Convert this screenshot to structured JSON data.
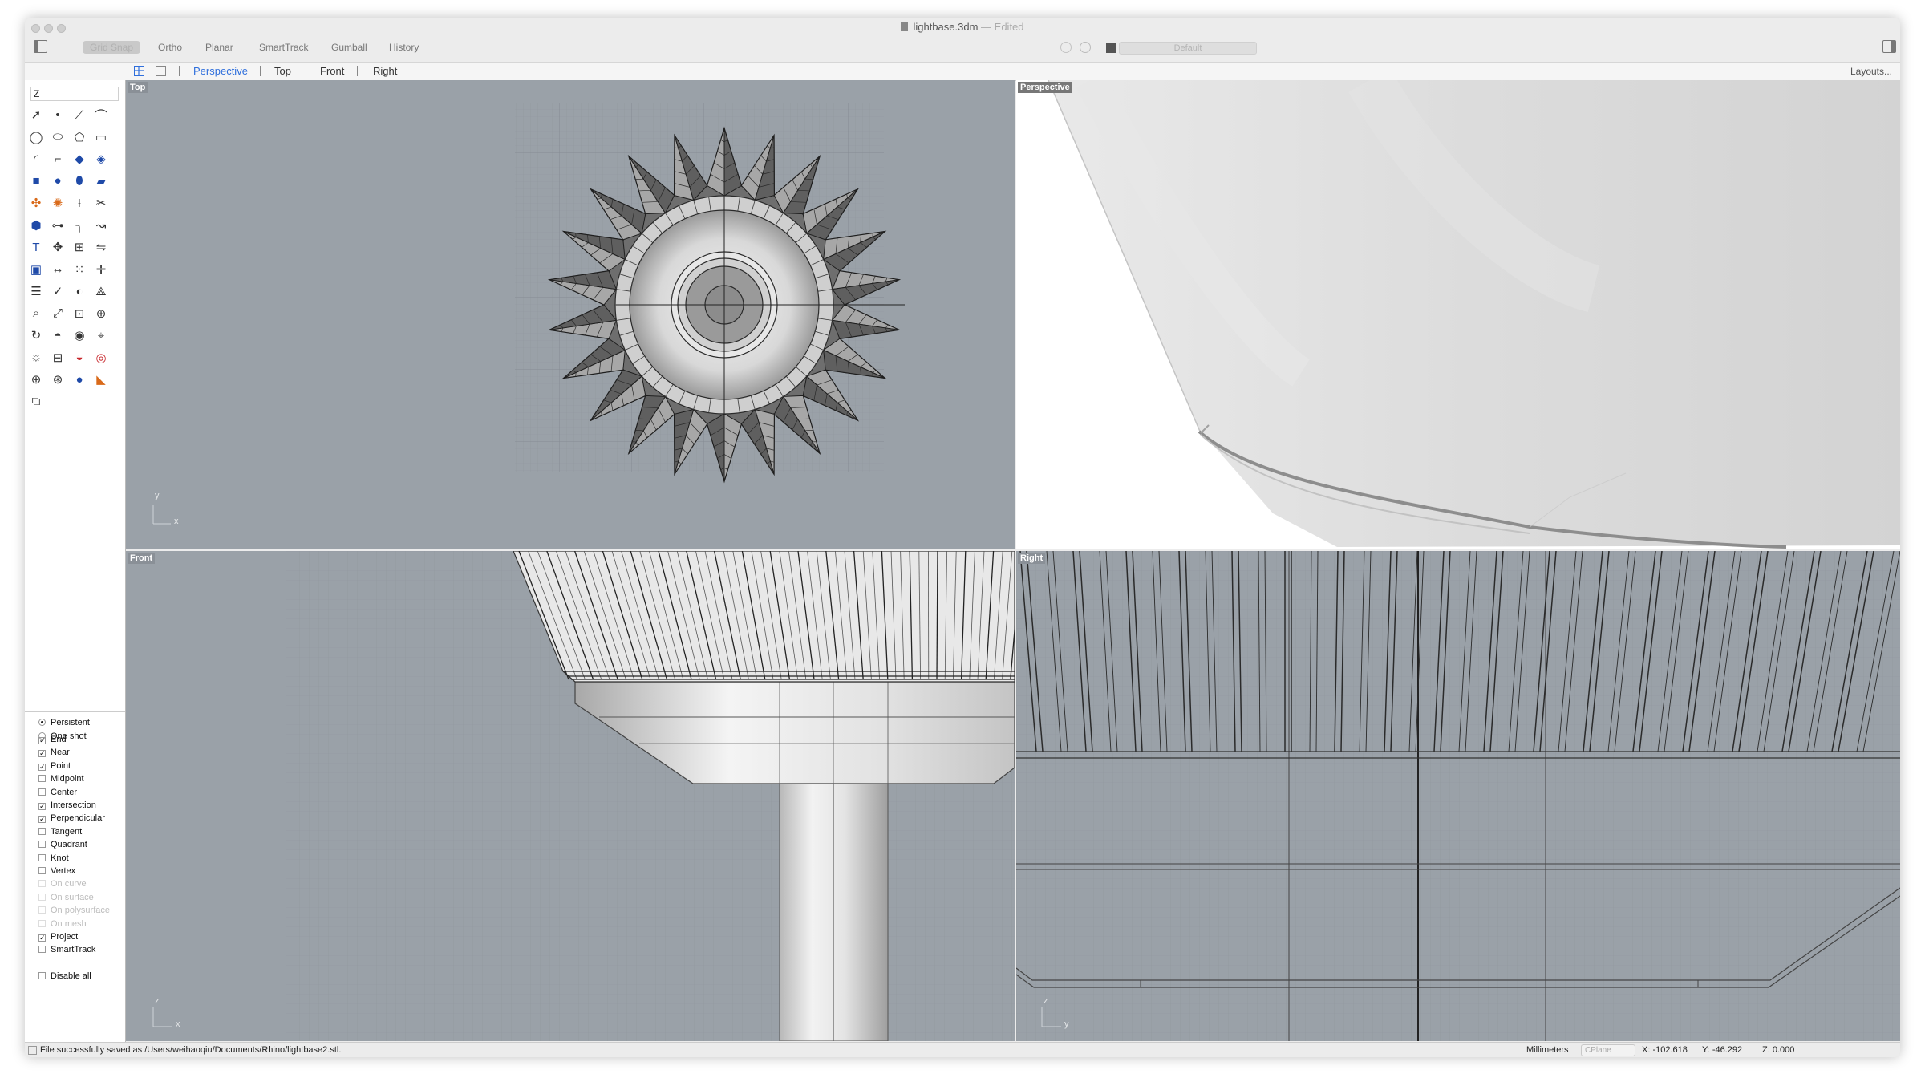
{
  "window": {
    "title": "lightbase.3dm",
    "title_separator": "—",
    "edited_label": "Edited"
  },
  "toolbar": {
    "toggles": [
      "Grid Snap",
      "Ortho",
      "Planar",
      "SmartTrack",
      "Gumball",
      "History"
    ],
    "active_toggle": "Grid Snap",
    "layer": "Default"
  },
  "viewport_tabs": {
    "items": [
      "Perspective",
      "Top",
      "Front",
      "Right"
    ],
    "active": "Perspective",
    "layouts_label": "Layouts..."
  },
  "command": {
    "value": "Z"
  },
  "osnap": {
    "modes": [
      {
        "label": "Persistent",
        "selected": true
      },
      {
        "label": "One shot",
        "selected": false
      }
    ],
    "items": [
      {
        "label": "End",
        "checked": true,
        "enabled": true
      },
      {
        "label": "Near",
        "checked": true,
        "enabled": true
      },
      {
        "label": "Point",
        "checked": true,
        "enabled": true
      },
      {
        "label": "Midpoint",
        "checked": false,
        "enabled": true
      },
      {
        "label": "Center",
        "checked": false,
        "enabled": true
      },
      {
        "label": "Intersection",
        "checked": true,
        "enabled": true
      },
      {
        "label": "Perpendicular",
        "checked": true,
        "enabled": true
      },
      {
        "label": "Tangent",
        "checked": false,
        "enabled": true
      },
      {
        "label": "Quadrant",
        "checked": false,
        "enabled": true
      },
      {
        "label": "Knot",
        "checked": false,
        "enabled": true
      },
      {
        "label": "Vertex",
        "checked": false,
        "enabled": true
      },
      {
        "label": "On curve",
        "checked": false,
        "enabled": false
      },
      {
        "label": "On surface",
        "checked": false,
        "enabled": false
      },
      {
        "label": "On polysurface",
        "checked": false,
        "enabled": false
      },
      {
        "label": "On mesh",
        "checked": false,
        "enabled": false
      },
      {
        "label": "Project",
        "checked": true,
        "enabled": true
      },
      {
        "label": "SmartTrack",
        "checked": false,
        "enabled": true
      }
    ],
    "disable_all": "Disable all"
  },
  "viewports": {
    "top": {
      "label": "Top",
      "axis_v": "y",
      "axis_h": "x"
    },
    "perspective": {
      "label": "Perspective"
    },
    "front": {
      "label": "Front",
      "axis_v": "z",
      "axis_h": "x"
    },
    "right": {
      "label": "Right",
      "axis_v": "z",
      "axis_h": "y"
    }
  },
  "status": {
    "message": "File successfully saved as /Users/weihaoqiu/Documents/Rhino/lightbase2.stl.",
    "units": "Millimeters",
    "cplane": "CPlane",
    "x": "X: -102.618",
    "y": "Y: -46.292",
    "z": "Z: 0.000"
  },
  "tool_icons": [
    "select-arrow",
    "point",
    "polyline",
    "curve-cv",
    "circle",
    "ellipse",
    "polygon",
    "rectangle",
    "arc",
    "fillet-curve",
    "surface-from-points",
    "patch-surface",
    "box",
    "sphere",
    "cylinder",
    "extrude",
    "boolean-union",
    "explode",
    "split",
    "trim",
    "solid-tools",
    "join",
    "fillet-edge",
    "blend-curve",
    "text",
    "move",
    "array",
    "mirror",
    "box-edit",
    "dimension",
    "array-grid",
    "gumball",
    "properties",
    "check",
    "sweep",
    "analyze",
    "zoom-window",
    "zoom-extents",
    "zoom-selected",
    "zoom-dynamic",
    "rotate-view",
    "render",
    "named-view",
    "cplane",
    "light",
    "lock",
    "material",
    "color-wheel",
    "globe-wire",
    "sphere-ghost",
    "render-sphere",
    "drafting",
    "block"
  ]
}
